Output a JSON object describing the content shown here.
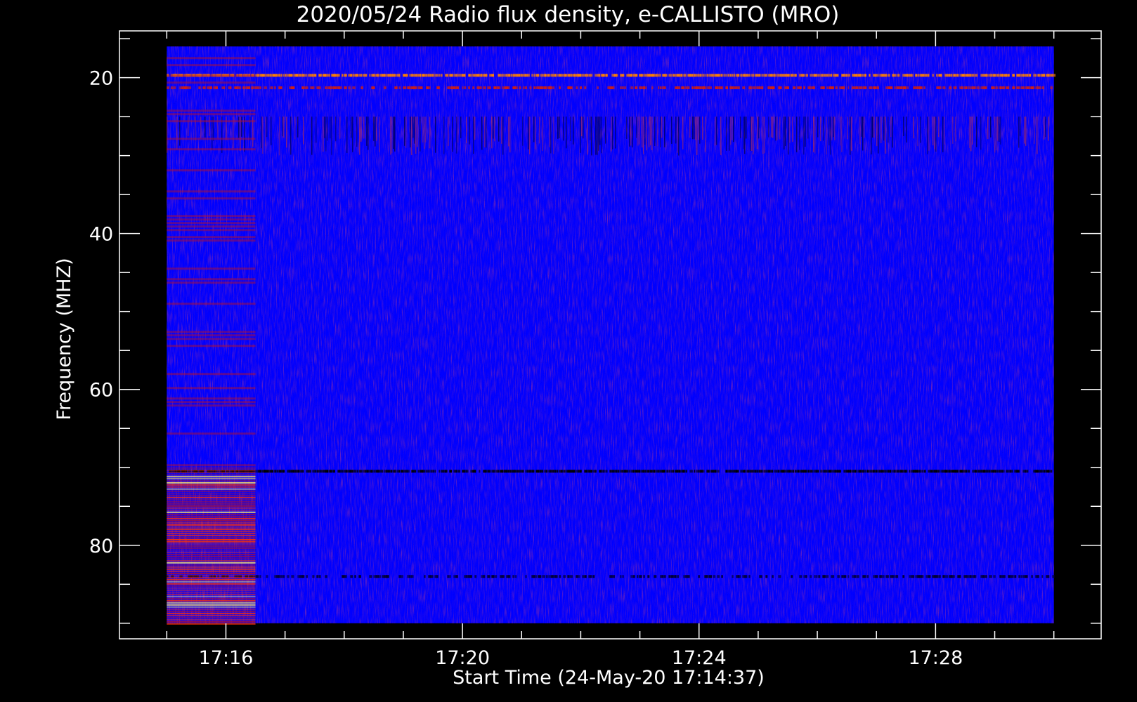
{
  "chart_data": {
    "type": "heatmap",
    "title": "2020/05/24  Radio flux density, e-CALLISTO (MRO)",
    "xlabel": "Start Time (24-May-20 17:14:37)",
    "ylabel": "Frequency (MHZ)",
    "x_ticks": [
      "17:16",
      "17:20",
      "17:24",
      "17:28"
    ],
    "x_tick_minutes": [
      16,
      20,
      24,
      28
    ],
    "x_range_minutes": [
      15.0,
      30.0
    ],
    "xlim_minutes": [
      14.2,
      30.8
    ],
    "y_ticks": [
      20,
      40,
      60,
      80
    ],
    "y_minor_step": 5,
    "ylim": [
      14,
      92
    ],
    "y_data_range": [
      16,
      90
    ],
    "reversed_y": true,
    "colormap": [
      "#000000",
      "#0000ff",
      "#b01030",
      "#ff3000",
      "#ffe060"
    ],
    "features": [
      {
        "kind": "hline",
        "freq": 19.7,
        "color": "#ff8000",
        "strength": 0.9
      },
      {
        "kind": "hline",
        "freq": 21.3,
        "color": "#d02010",
        "strength": 0.6
      },
      {
        "kind": "band",
        "freq": [
          25,
          30
        ],
        "color": "#c03040",
        "strength": 0.6
      },
      {
        "kind": "hline",
        "freq": 70.5,
        "color": "#000000",
        "strength": 0.9
      },
      {
        "kind": "hline",
        "freq": 84.0,
        "color": "#000030",
        "strength": 0.5
      },
      {
        "kind": "early_block",
        "time_end_minutes": 16.5,
        "freq": [
          70,
          90
        ],
        "color": "#ff3000"
      }
    ]
  }
}
